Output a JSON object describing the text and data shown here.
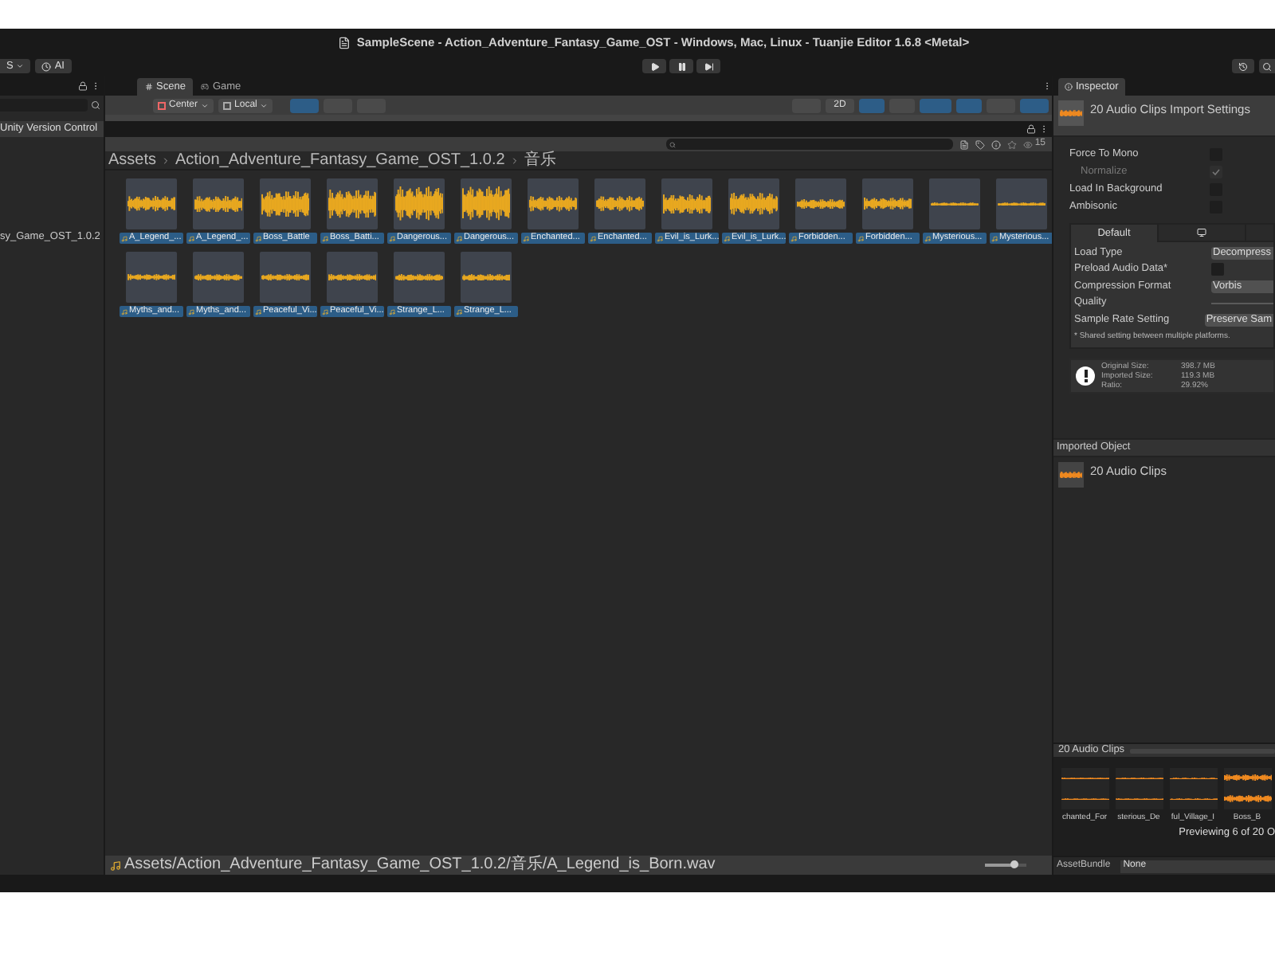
{
  "window": {
    "title": "SampleScene - Action_Adventure_Fantasy_Game_OST - Windows, Mac, Linux - Tuanjie Editor 1.6.8 <Metal>"
  },
  "toolbar": {
    "account": "S",
    "ai": "AI"
  },
  "hierarchy": {
    "items": [
      {
        "label": "Unity Version Control"
      }
    ]
  },
  "project_tree": {
    "items": [
      {
        "label": "sy_Game_OST_1.0.2"
      }
    ]
  },
  "scene_tabs": [
    {
      "label": "Scene",
      "selected": true
    },
    {
      "label": "Game",
      "selected": false
    }
  ],
  "scene_toolbar": {
    "pivot": "Center",
    "space": "Local",
    "mode_2d": "2D"
  },
  "project": {
    "count": "15",
    "breadcrumb": [
      "Assets",
      "Action_Adventure_Fantasy_Game_OST_1.0.2",
      "音乐"
    ],
    "assets": [
      {
        "label": "A_Legend_...",
        "selected": true
      },
      {
        "label": "A_Legend_...",
        "selected": true
      },
      {
        "label": "Boss_Battle",
        "selected": true
      },
      {
        "label": "Boss_Batti...",
        "selected": true
      },
      {
        "label": "Dangerous...",
        "selected": true
      },
      {
        "label": "Dangerous...",
        "selected": true
      },
      {
        "label": "Enchanted...",
        "selected": true
      },
      {
        "label": "Enchanted...",
        "selected": true
      },
      {
        "label": "Evil_is_Lurk...",
        "selected": true
      },
      {
        "label": "Evil_is_Lurk...",
        "selected": true
      },
      {
        "label": "Forbidden...",
        "selected": true
      },
      {
        "label": "Forbidden...",
        "selected": true
      },
      {
        "label": "Mysterious...",
        "selected": true
      },
      {
        "label": "Mysterious...",
        "selected": true
      },
      {
        "label": "Myths_and...",
        "selected": true
      },
      {
        "label": "Myths_and...",
        "selected": true
      },
      {
        "label": "Peaceful_Vi...",
        "selected": true
      },
      {
        "label": "Peaceful_Vi...",
        "selected": true
      },
      {
        "label": "Strange_L...",
        "selected": true
      },
      {
        "label": "Strange_L...",
        "selected": true
      }
    ],
    "footer_path": "Assets/Action_Adventure_Fantasy_Game_OST_1.0.2/音乐/A_Legend_is_Born.wav",
    "zoom": {
      "level": 0.7
    }
  },
  "inspector": {
    "tab": "Inspector",
    "title": "20 Audio Clips Import Settings",
    "options": [
      {
        "label": "Force To Mono",
        "checked": false,
        "disabled": false
      },
      {
        "label": "Normalize",
        "checked": true,
        "disabled": true
      },
      {
        "label": "Load In Background",
        "checked": false,
        "disabled": false
      },
      {
        "label": "Ambisonic",
        "checked": false,
        "disabled": false
      }
    ],
    "platform_tabs": [
      {
        "kind": "text",
        "label": "Default",
        "selected": true
      },
      {
        "kind": "monitor",
        "selected": false
      }
    ],
    "fields": [
      {
        "kind": "dropdown",
        "label": "Load Type",
        "value": "Decompress"
      },
      {
        "kind": "checkbox",
        "label": "Preload Audio Data*",
        "checked": false
      },
      {
        "kind": "dropdown",
        "label": "Compression Format",
        "value": "Vorbis"
      },
      {
        "kind": "slider",
        "label": "Quality"
      },
      {
        "kind": "dropdown",
        "label": "Sample Rate Setting",
        "value": "Preserve Sam"
      }
    ],
    "note": "* Shared setting between multiple platforms.",
    "info": [
      {
        "label": "Original Size:",
        "value": "398.7 MB"
      },
      {
        "label": "Imported Size:",
        "value": "119.3 MB"
      },
      {
        "label": "Ratio:",
        "value": "29.92%"
      }
    ],
    "imported_object": {
      "header": "Imported Object",
      "name": "20 Audio Clips"
    },
    "preview": {
      "title": "20 Audio Clips",
      "clips": [
        "chanted_For",
        "sterious_De",
        "ful_Village_I",
        "Boss_B"
      ],
      "caption": "Previewing 6 of 20 O"
    },
    "asset_bundle": {
      "label": "AssetBundle",
      "value": "None"
    }
  }
}
